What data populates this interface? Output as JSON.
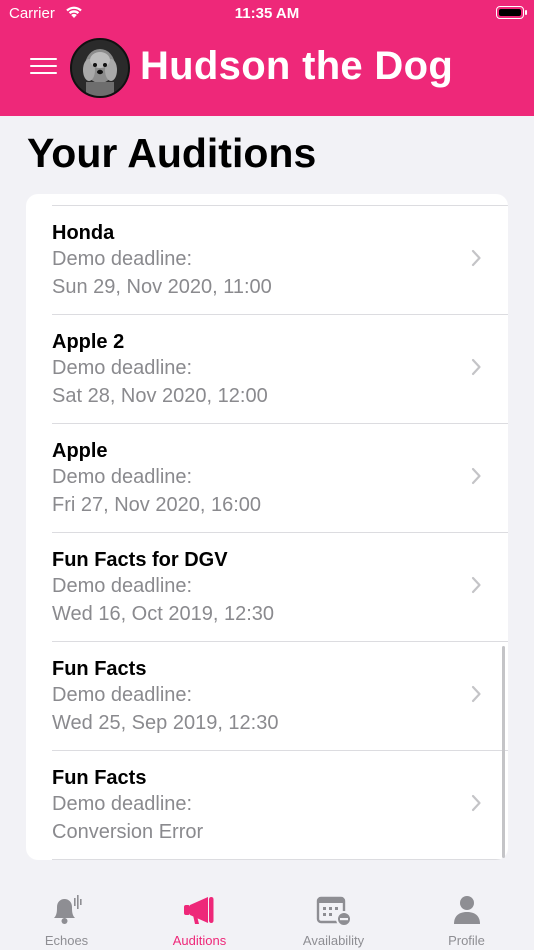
{
  "status_bar": {
    "carrier": "Carrier",
    "time": "11:35 AM"
  },
  "header": {
    "title": "Hudson the Dog",
    "accent_color": "#ee2879"
  },
  "page": {
    "title": "Your Auditions"
  },
  "auditions": [
    {
      "name": "Honda",
      "label": "Demo deadline:",
      "date": "Sun 29, Nov 2020, 11:00"
    },
    {
      "name": "Apple 2",
      "label": "Demo deadline:",
      "date": "Sat 28, Nov 2020, 12:00"
    },
    {
      "name": "Apple",
      "label": "Demo deadline:",
      "date": "Fri 27, Nov 2020, 16:00"
    },
    {
      "name": "Fun Facts for DGV",
      "label": "Demo deadline:",
      "date": "Wed 16, Oct 2019, 12:30"
    },
    {
      "name": "Fun Facts",
      "label": "Demo deadline:",
      "date": "Wed 25, Sep 2019, 12:30"
    },
    {
      "name": "Fun Facts",
      "label": "Demo deadline:",
      "date": "Conversion Error"
    }
  ],
  "tabs": [
    {
      "label": "Echoes",
      "icon": "bell-icon",
      "active": false
    },
    {
      "label": "Auditions",
      "icon": "megaphone-icon",
      "active": true
    },
    {
      "label": "Availability",
      "icon": "calendar-icon",
      "active": false
    },
    {
      "label": "Profile",
      "icon": "person-icon",
      "active": false
    }
  ]
}
